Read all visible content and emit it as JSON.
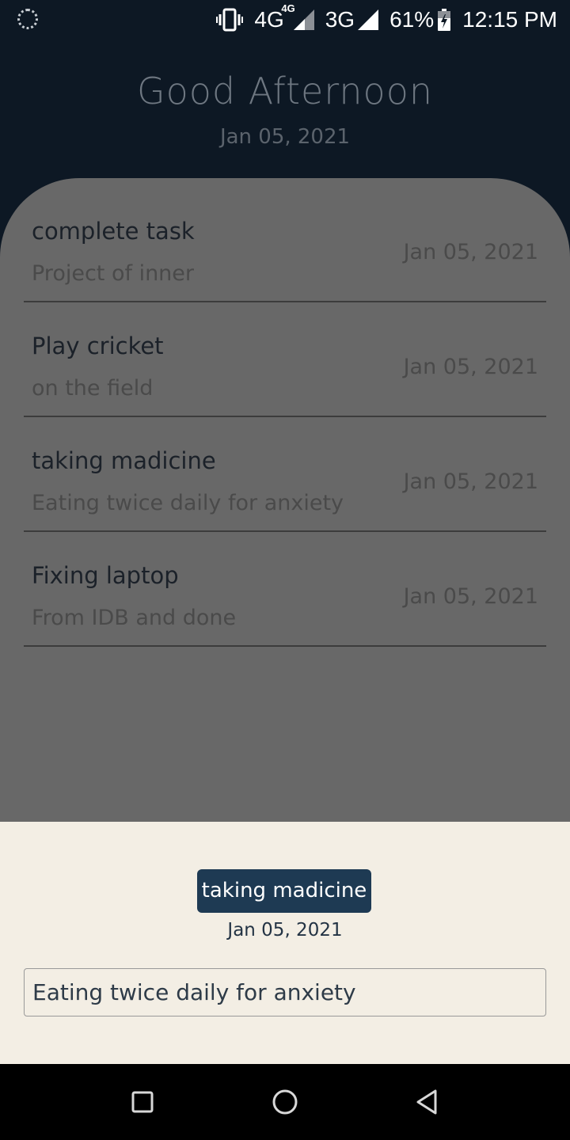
{
  "status_bar": {
    "network1": "4G",
    "network1_badge": "4G",
    "network2": "3G",
    "battery": "61%",
    "time": "12:15 PM",
    "icons": [
      "loader-icon",
      "vibrate-icon",
      "signal-icon",
      "signal-icon",
      "battery-charging-icon"
    ]
  },
  "header": {
    "greeting": "Good Afternoon",
    "date": "Jan 05, 2021"
  },
  "tasks": [
    {
      "title": "complete task",
      "description": "Project of inner",
      "date": "Jan 05, 2021"
    },
    {
      "title": "Play cricket",
      "description": "on the field",
      "date": "Jan 05, 2021"
    },
    {
      "title": "taking madicine",
      "description": "Eating twice daily for anxiety",
      "date": "Jan 05, 2021"
    },
    {
      "title": "Fixing laptop",
      "description": "From IDB and done",
      "date": "Jan 05, 2021"
    }
  ],
  "detail_sheet": {
    "title": "taking madicine",
    "date": "Jan 05, 2021",
    "description_value": "Eating twice daily for anxiety"
  },
  "nav_bar": {
    "icons": [
      "recents-square-icon",
      "home-circle-icon",
      "back-triangle-icon"
    ]
  },
  "colors": {
    "header_bg": "#0d1824",
    "overlay_panel": "#686868",
    "sheet_bg": "#f3eee4",
    "chip_bg": "#1e3a53"
  }
}
